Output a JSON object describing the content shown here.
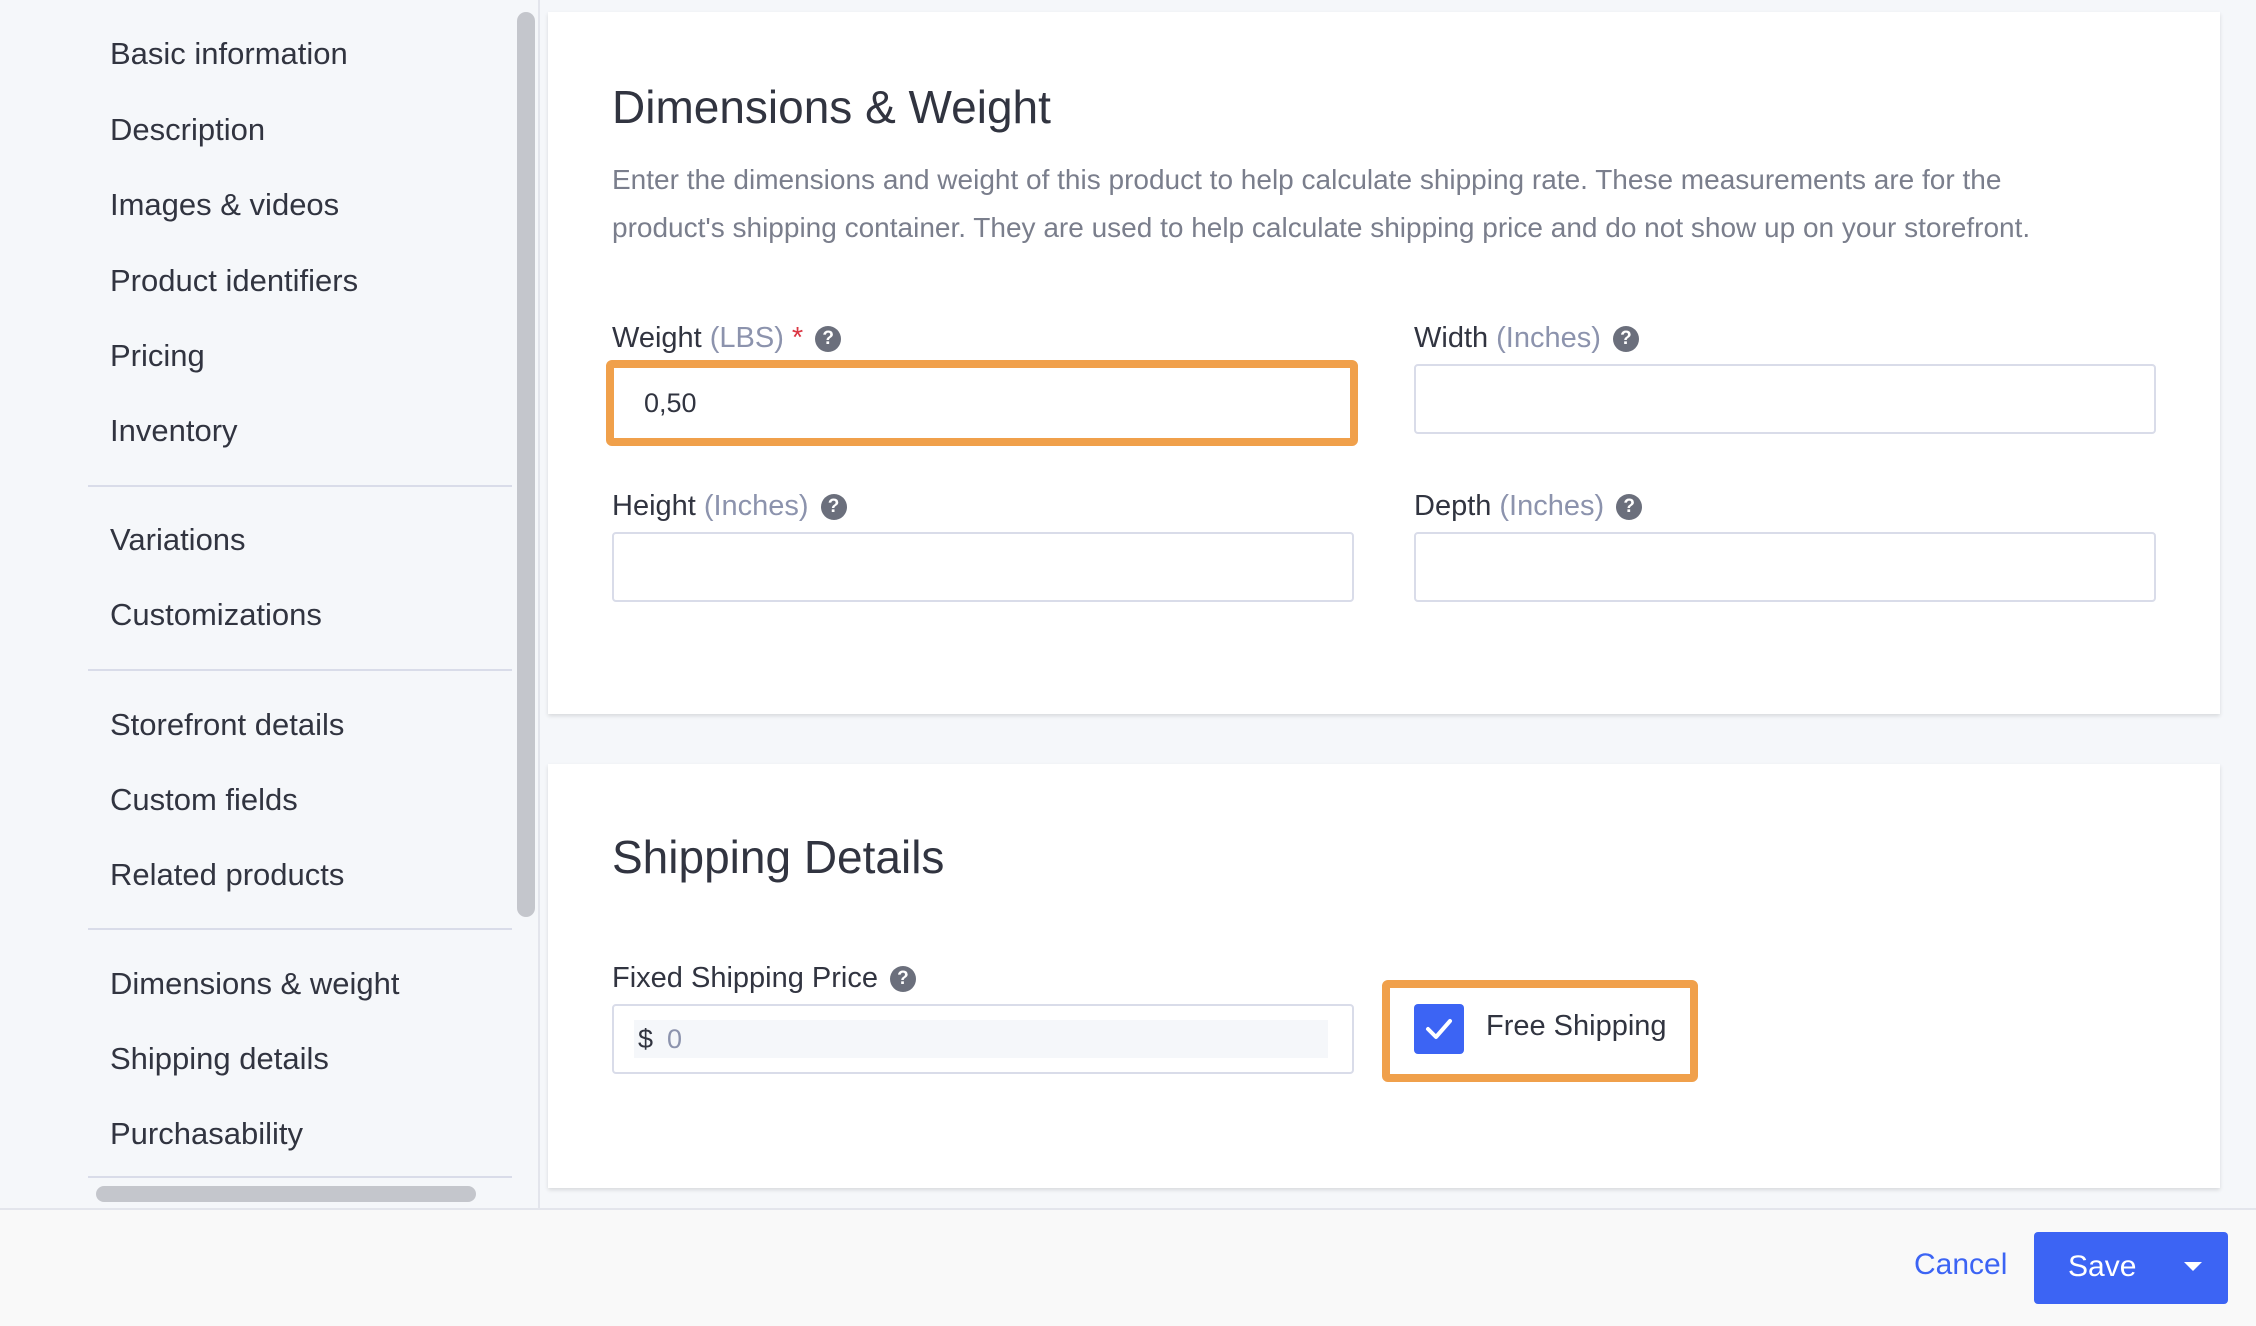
{
  "sidebar": {
    "items": [
      {
        "label": "Basic information"
      },
      {
        "label": "Description"
      },
      {
        "label": "Images & videos"
      },
      {
        "label": "Product identifiers"
      },
      {
        "label": "Pricing"
      },
      {
        "label": "Inventory"
      },
      {
        "label": "Variations"
      },
      {
        "label": "Customizations"
      },
      {
        "label": "Storefront details"
      },
      {
        "label": "Custom fields"
      },
      {
        "label": "Related products"
      },
      {
        "label": "Dimensions & weight"
      },
      {
        "label": "Shipping details"
      },
      {
        "label": "Purchasability"
      }
    ]
  },
  "dimensions": {
    "title": "Dimensions & Weight",
    "description": "Enter the dimensions and weight of this product to help calculate shipping rate. These measurements are for the product's shipping container. They are used to help calculate shipping price and do not show up on your storefront.",
    "weight": {
      "label": "Weight",
      "unit": "(LBS)",
      "required_mark": "*",
      "value": "0,50"
    },
    "width": {
      "label": "Width",
      "unit": "(Inches)",
      "value": ""
    },
    "height": {
      "label": "Height",
      "unit": "(Inches)",
      "value": ""
    },
    "depth": {
      "label": "Depth",
      "unit": "(Inches)",
      "value": ""
    }
  },
  "shipping": {
    "title": "Shipping Details",
    "fixed_price": {
      "label": "Fixed Shipping Price",
      "currency": "$",
      "placeholder": "0"
    },
    "free_shipping": {
      "label": "Free Shipping",
      "checked": true
    }
  },
  "footer": {
    "cancel_label": "Cancel",
    "save_label": "Save"
  },
  "colors": {
    "accent": "#3c64f4",
    "highlight": "#f0a04b",
    "required": "#db3643"
  },
  "icons": {
    "help": "?",
    "check": "checkmark-icon",
    "caret": "chevron-down-icon"
  }
}
